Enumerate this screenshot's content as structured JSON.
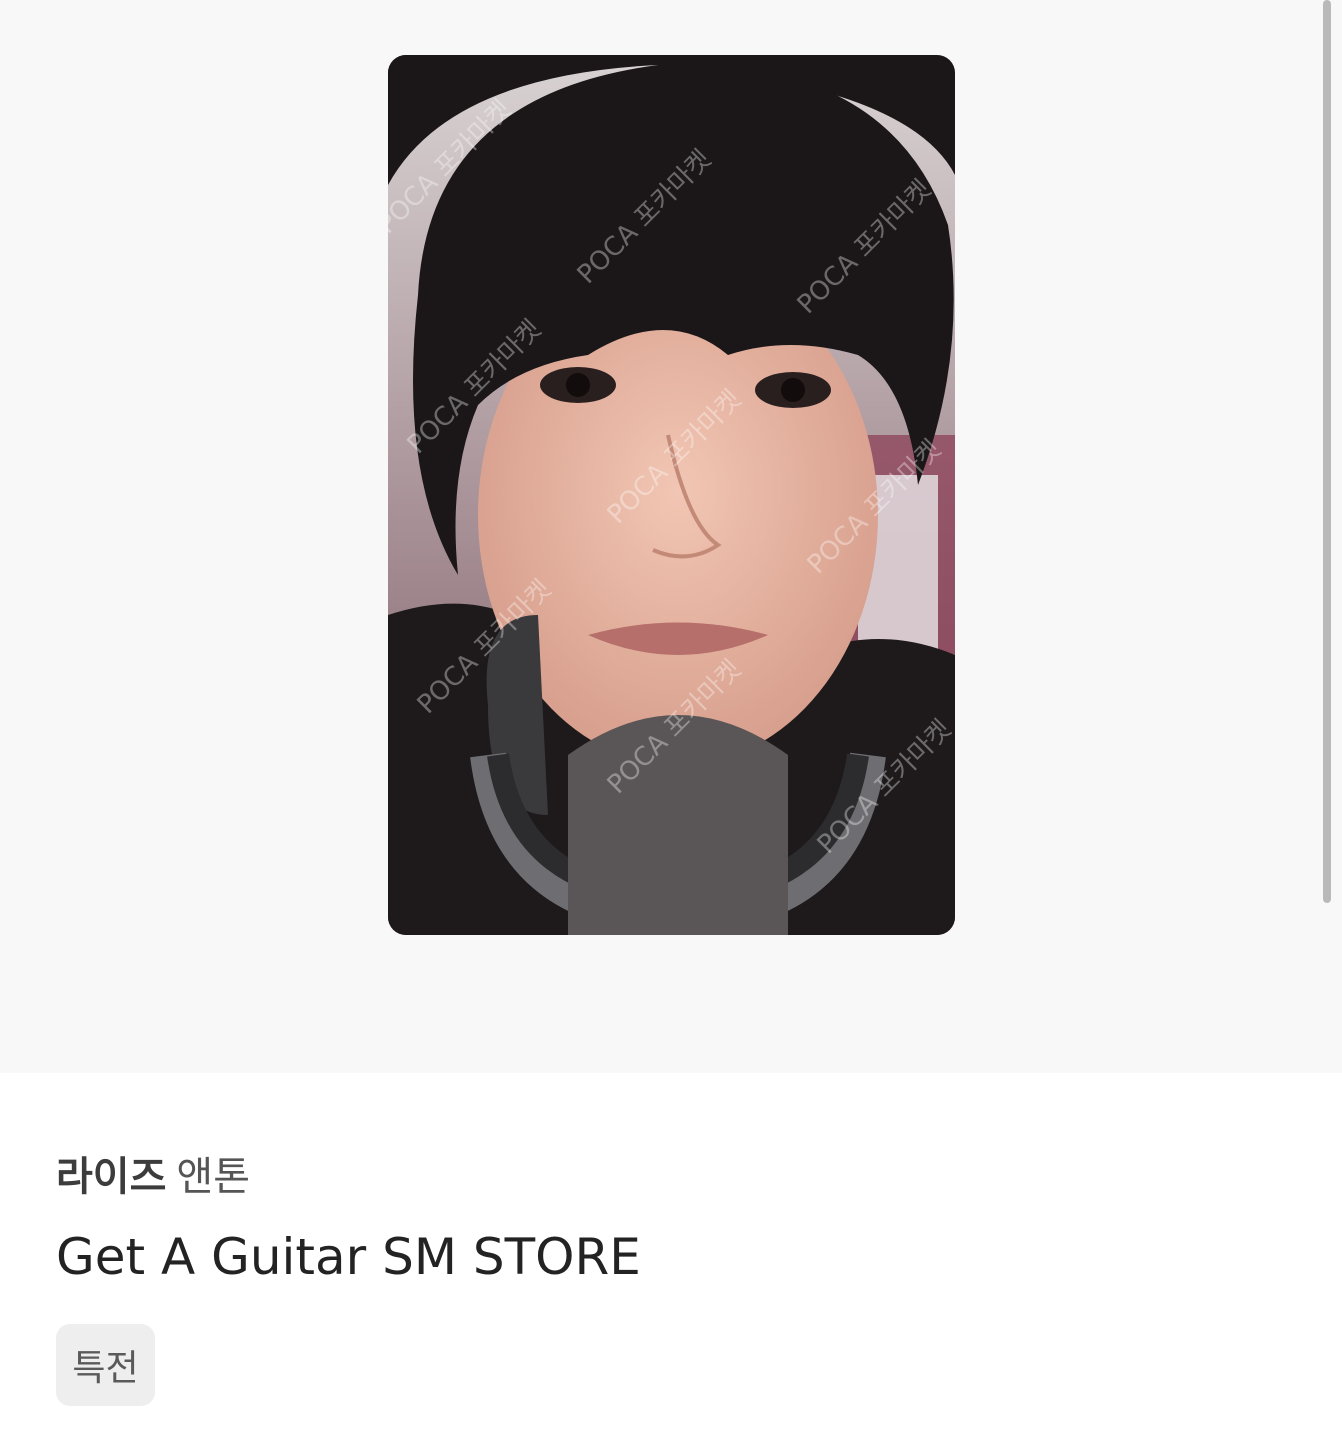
{
  "item": {
    "group": "라이즈",
    "member": "앤톤",
    "title": "Get A Guitar SM STORE",
    "tags": [
      "특전"
    ]
  },
  "image": {
    "description": "photocard",
    "watermark_text": "POCA 포카마켓",
    "icon": "photocard-image"
  },
  "colors": {
    "image_background": "#f8f8f8",
    "tag_background": "#eeeeee",
    "title_text": "#232323"
  }
}
